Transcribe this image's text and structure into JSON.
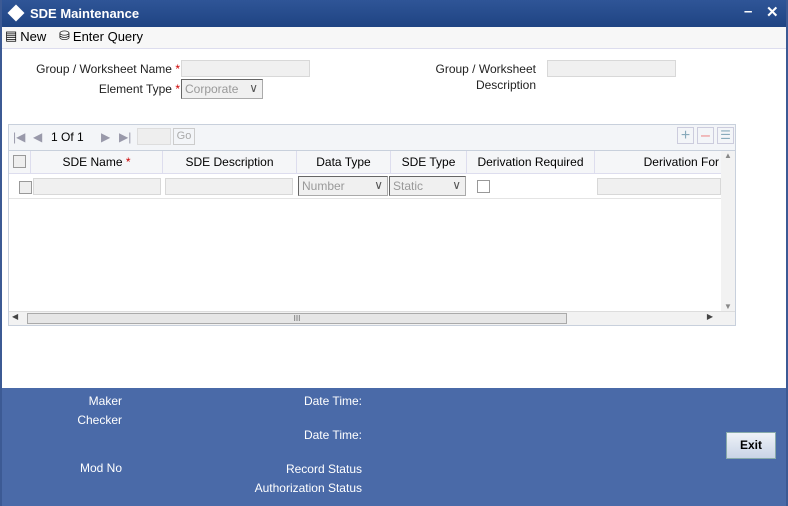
{
  "title": "SDE Maintenance",
  "toolbar": {
    "new_label": "New",
    "enter_query_label": "Enter Query"
  },
  "form": {
    "group_name_label": "Group / Worksheet Name",
    "group_name_value": "",
    "element_type_label": "Element Type",
    "element_type_value": "Corporate",
    "group_desc_label1": "Group / Worksheet",
    "group_desc_label2": "Description",
    "group_desc_value": "",
    "required_mark": "*"
  },
  "grid": {
    "pager": {
      "text": "1 Of 1",
      "go_label": "Go",
      "page_value": ""
    },
    "columns": [
      "SDE Name",
      "SDE Description",
      "Data Type",
      "SDE Type",
      "Derivation Required",
      "Derivation For"
    ],
    "row": {
      "sde_name": "",
      "sde_description": "",
      "data_type": "Number",
      "sde_type": "Static",
      "derivation_required": false,
      "derivation_for": ""
    },
    "hscroll_grip": "III"
  },
  "footer": {
    "maker": "Maker",
    "checker": "Checker",
    "date_time": "Date Time:",
    "mod_no": "Mod No",
    "record_status": "Record Status",
    "authorization_status": "Authorization Status",
    "exit_label": "Exit"
  }
}
